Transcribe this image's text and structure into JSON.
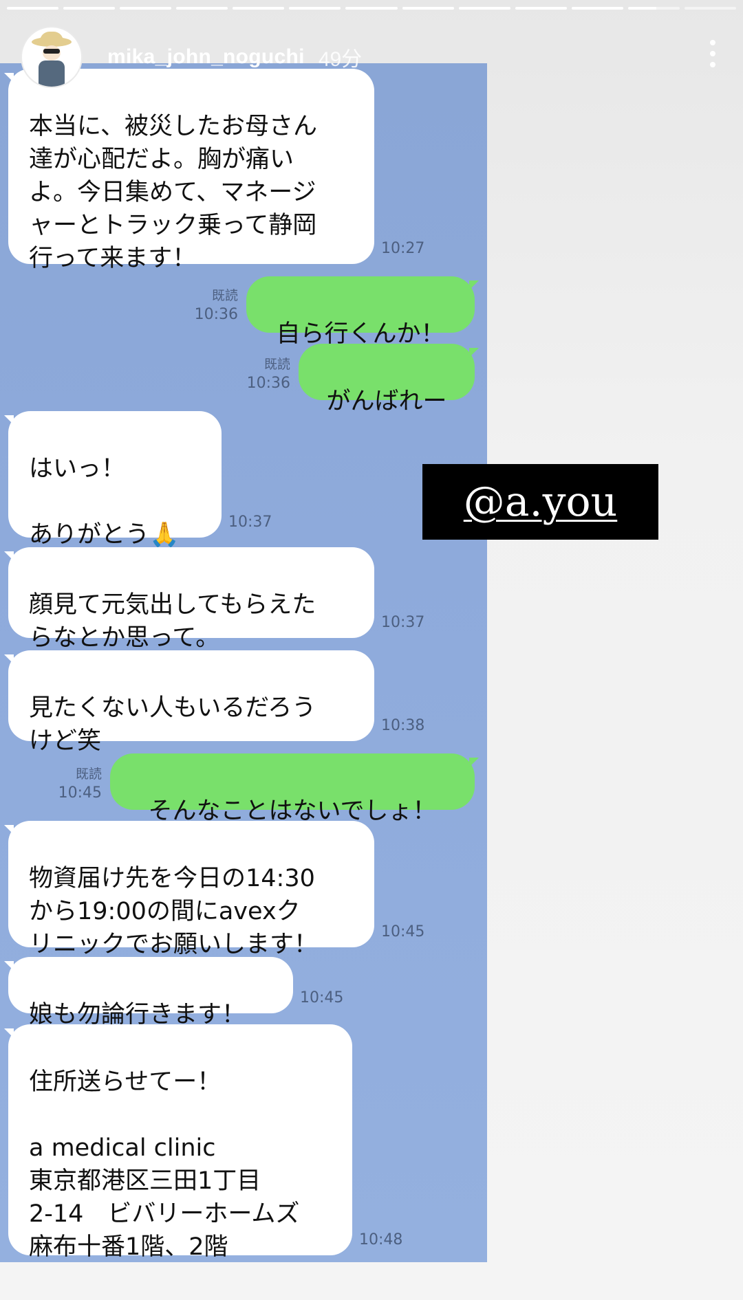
{
  "story": {
    "username": "mika_john_noguchi",
    "posted_ago": "49分",
    "progress_segments": 13,
    "progress_done": 11
  },
  "mention_sticker": {
    "text": "@a.you"
  },
  "messages": [
    {
      "side": "in",
      "text": "本当に、被災したお母さん\n達が心配だよ。胸が痛い\nよ。今日集めて、マネージ\nャーとトラック乗って静岡\n行って来ます！",
      "time": "10:27"
    },
    {
      "side": "out",
      "text": "自ら行くんか！",
      "read": "既読",
      "time": "10:36"
    },
    {
      "side": "out",
      "text": "がんばれー",
      "read": "既読",
      "time": "10:36"
    },
    {
      "side": "in",
      "text": "はいっ！\n\nありがとう🙏",
      "time": "10:37"
    },
    {
      "side": "in",
      "text": "顔見て元気出してもらえた\nらなとか思って。",
      "time": "10:37"
    },
    {
      "side": "in",
      "text": "見たくない人もいるだろう\nけど笑",
      "time": "10:38"
    },
    {
      "side": "out",
      "text": "そんなことはないでしょ！",
      "read": "既読",
      "time": "10:45"
    },
    {
      "side": "in",
      "text": "物資届け先を今日の14:30\nから19:00の間にavexク\nリニックでお願いします！",
      "time": "10:45"
    },
    {
      "side": "in",
      "text": "娘も勿論行きます！",
      "time": "10:45"
    },
    {
      "side": "in",
      "text": "住所送らせてー！\n\na medical clinic\n東京都港区三田1丁目\n2-14　ビバリーホームズ\n麻布十番1階、2階",
      "time": "10:48"
    }
  ]
}
